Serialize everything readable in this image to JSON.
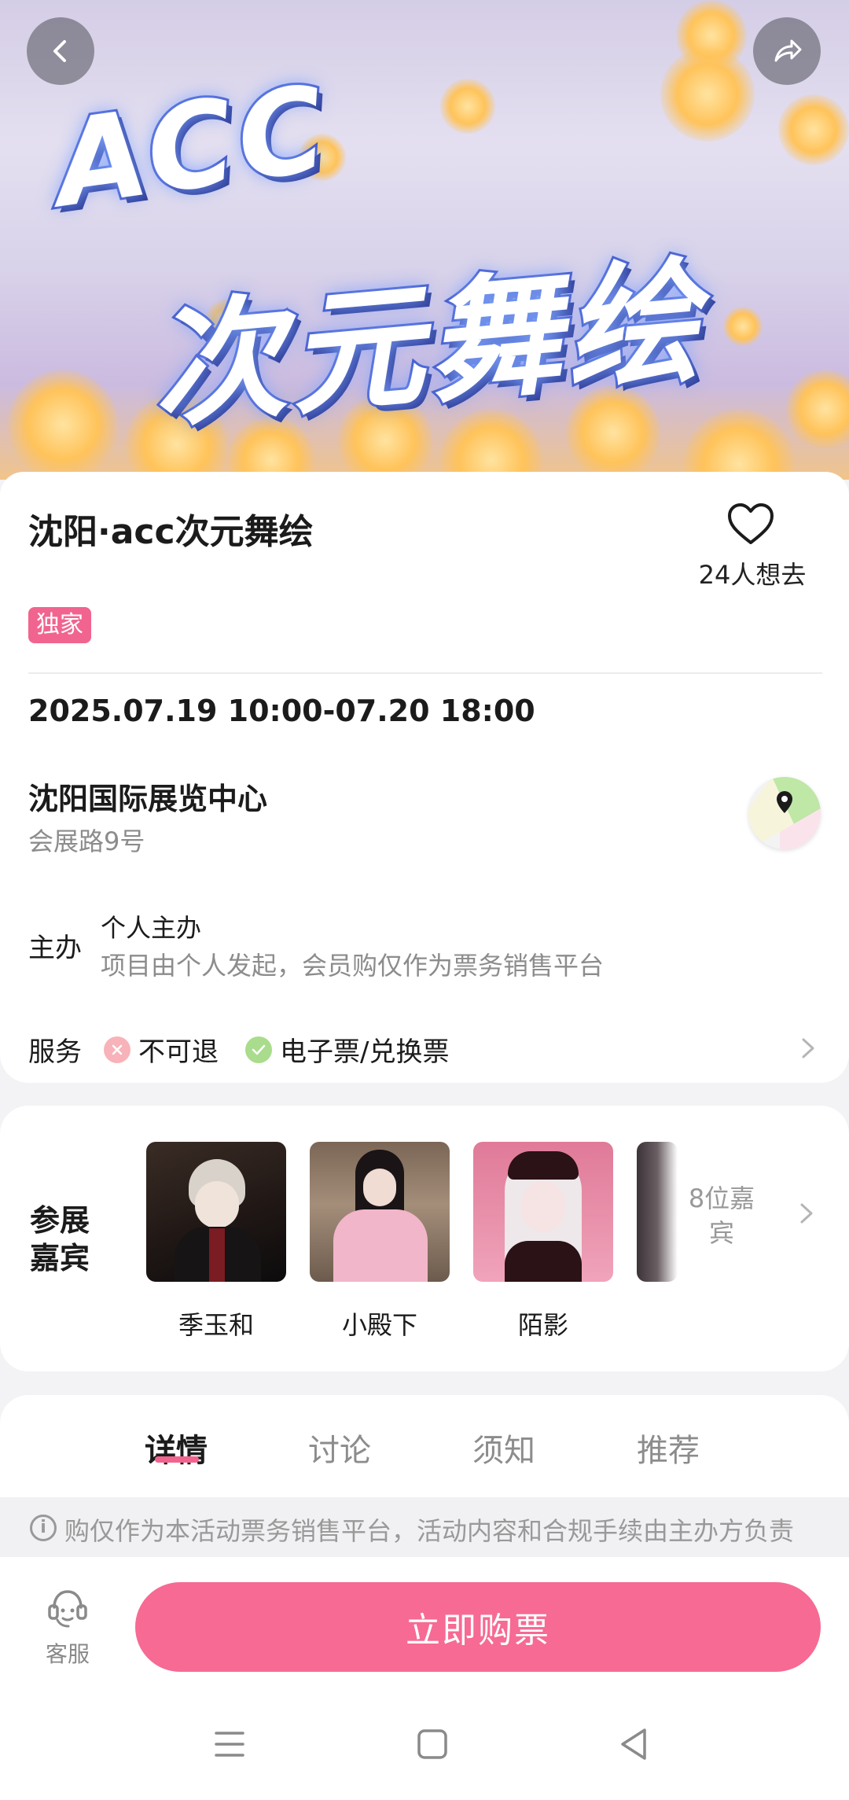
{
  "banner": {
    "line1": "ACC",
    "line2": "次元舞绘"
  },
  "event": {
    "title": "沈阳·acc次元舞绘",
    "favorite_count": "24人想去",
    "badge": "独家",
    "datetime": "2025.07.19 10:00-07.20 18:00",
    "venue": "沈阳国际展览中心",
    "address": "会展路9号"
  },
  "organizer": {
    "label": "主办",
    "name": "个人主办",
    "description": "项目由个人发起，会员购仅作为票务销售平台"
  },
  "services": {
    "label": "服务",
    "items": [
      {
        "text": "不可退",
        "status": "no"
      },
      {
        "text": "电子票/兑换票",
        "status": "yes"
      }
    ]
  },
  "guests": {
    "label": "参展嘉宾",
    "list": [
      {
        "name": "季玉和"
      },
      {
        "name": "小殿下"
      },
      {
        "name": "陌影"
      }
    ],
    "more": "8位嘉宾"
  },
  "tabs": [
    {
      "label": "详情",
      "active": true
    },
    {
      "label": "讨论",
      "active": false
    },
    {
      "label": "须知",
      "active": false
    },
    {
      "label": "推荐",
      "active": false
    }
  ],
  "notice": "购仅作为本活动票务销售平台，活动内容和合规手续由主办方负责",
  "bottom": {
    "customer_service": "客服",
    "buy": "立即购票"
  },
  "colors": {
    "accent": "#f66a93",
    "badge": "#f1648f"
  }
}
